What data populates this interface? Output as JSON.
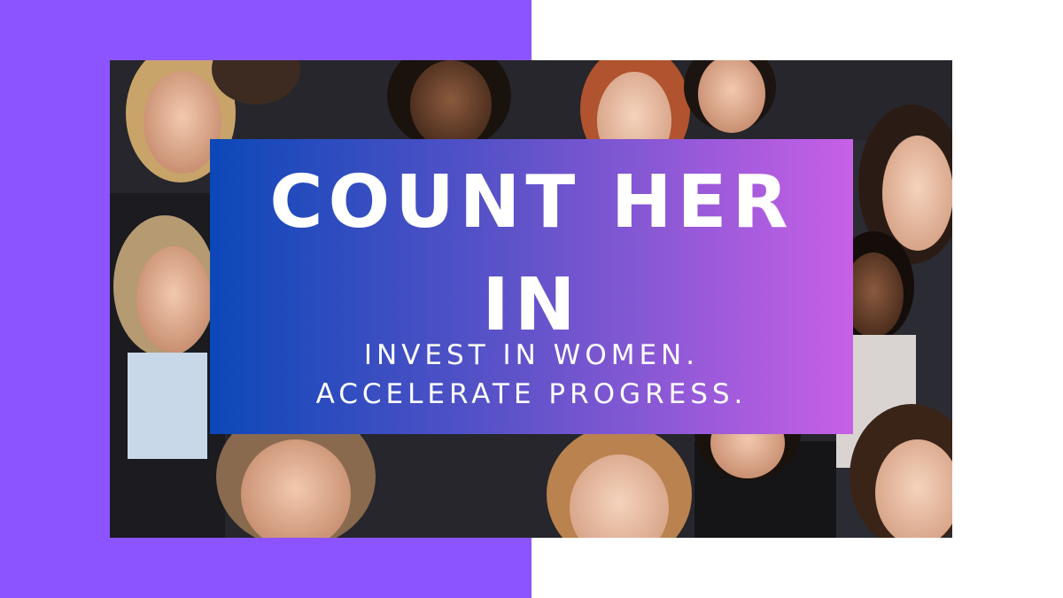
{
  "colors": {
    "left_panel": "#8c54ff",
    "right_panel": "#ffffff",
    "banner_gradient_start": "#0c48b8",
    "banner_gradient_end": "#c860e6",
    "text": "#ffffff"
  },
  "photo": {
    "subject": "crowd-of-women-photo"
  },
  "banner": {
    "headline_line1": "COUNT HER",
    "headline_line2": "IN",
    "tagline_line1": "INVEST IN WOMEN.",
    "tagline_line2": "ACCELERATE PROGRESS."
  }
}
